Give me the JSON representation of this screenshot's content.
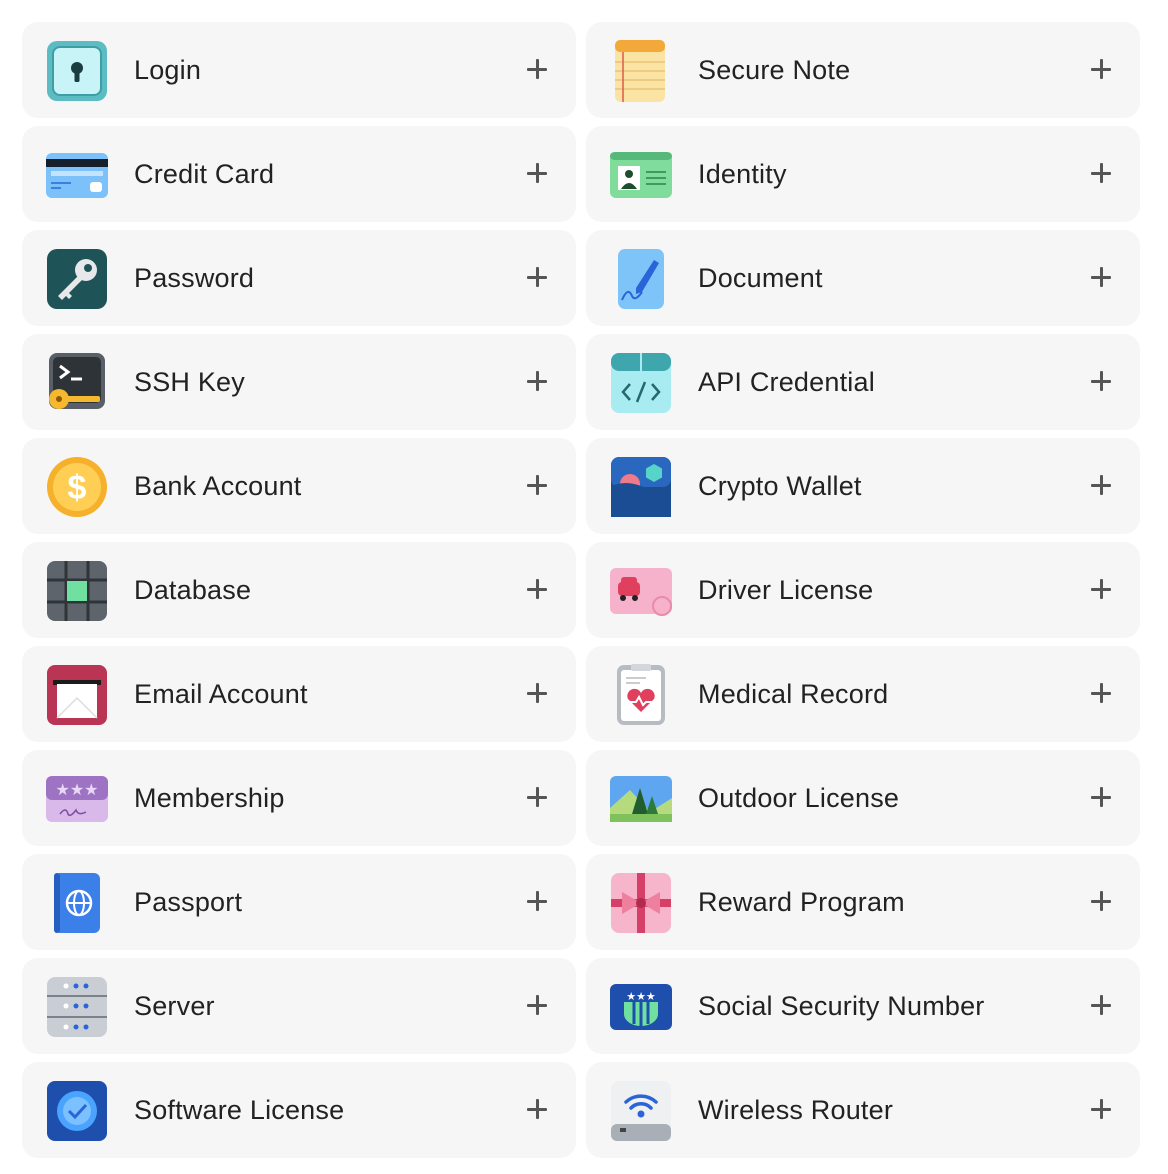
{
  "items": [
    {
      "label": "Login",
      "icon": "login-icon"
    },
    {
      "label": "Secure Note",
      "icon": "secure-note-icon"
    },
    {
      "label": "Credit Card",
      "icon": "credit-card-icon"
    },
    {
      "label": "Identity",
      "icon": "identity-icon"
    },
    {
      "label": "Password",
      "icon": "password-icon"
    },
    {
      "label": "Document",
      "icon": "document-icon"
    },
    {
      "label": "SSH Key",
      "icon": "ssh-key-icon"
    },
    {
      "label": "API Credential",
      "icon": "api-credential-icon"
    },
    {
      "label": "Bank Account",
      "icon": "bank-account-icon"
    },
    {
      "label": "Crypto Wallet",
      "icon": "crypto-wallet-icon"
    },
    {
      "label": "Database",
      "icon": "database-icon"
    },
    {
      "label": "Driver License",
      "icon": "driver-license-icon"
    },
    {
      "label": "Email Account",
      "icon": "email-account-icon"
    },
    {
      "label": "Medical Record",
      "icon": "medical-record-icon"
    },
    {
      "label": "Membership",
      "icon": "membership-icon"
    },
    {
      "label": "Outdoor License",
      "icon": "outdoor-license-icon"
    },
    {
      "label": "Passport",
      "icon": "passport-icon"
    },
    {
      "label": "Reward Program",
      "icon": "reward-program-icon"
    },
    {
      "label": "Server",
      "icon": "server-icon"
    },
    {
      "label": "Social Security Number",
      "icon": "social-security-number-icon"
    },
    {
      "label": "Software License",
      "icon": "software-license-icon"
    },
    {
      "label": "Wireless Router",
      "icon": "wireless-router-icon"
    }
  ],
  "add_icon": "plus-icon"
}
